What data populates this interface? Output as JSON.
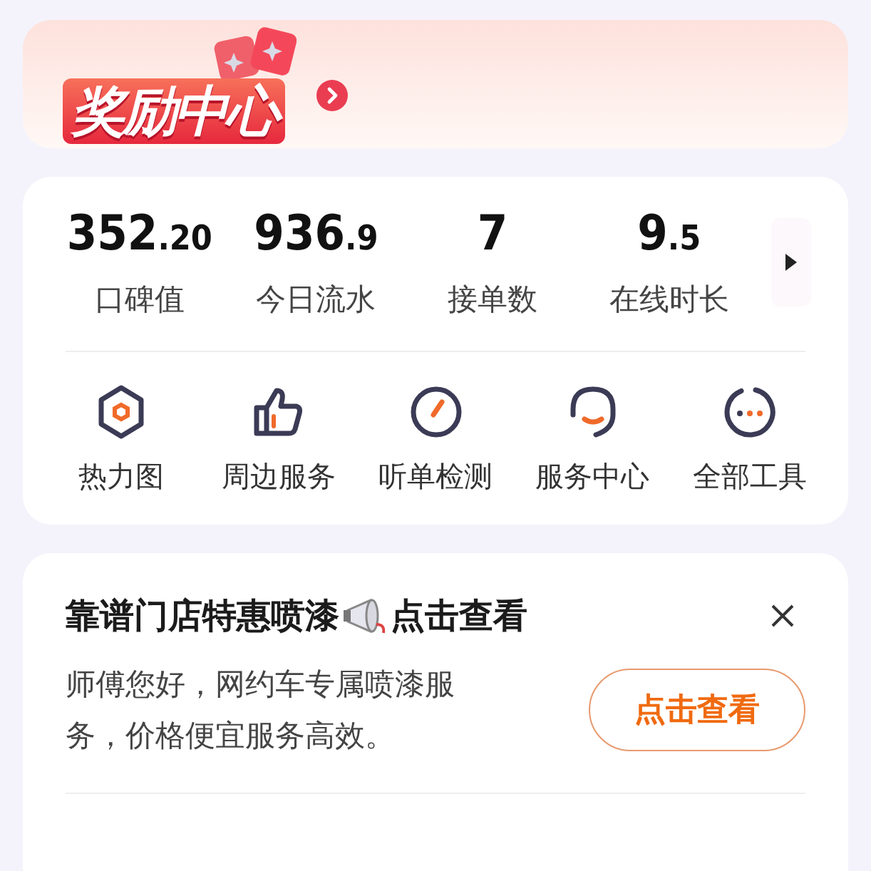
{
  "banner": {
    "title": "奖励中心"
  },
  "stats": [
    {
      "whole": "352",
      "fraction": ".20",
      "label": "口碑值"
    },
    {
      "whole": "936",
      "fraction": ".9",
      "label": "今日流水"
    },
    {
      "whole": "7",
      "label": "接单数"
    },
    {
      "whole": "9",
      "fraction": ".5",
      "label": "在线时长"
    }
  ],
  "tools": [
    {
      "kind": "hexagon",
      "label": "热力图"
    },
    {
      "kind": "thumb",
      "label": "周边服务"
    },
    {
      "kind": "gauge",
      "label": "听单检测"
    },
    {
      "kind": "headset",
      "label": "服务中心"
    },
    {
      "kind": "more",
      "label": "全部工具"
    }
  ],
  "promo": {
    "title_before": "靠谱门店特惠喷漆",
    "title_after": "点击查看",
    "text": "师傅您好，网约车专属喷漆服务，价格便宜服务高效。",
    "button": "点击查看"
  }
}
